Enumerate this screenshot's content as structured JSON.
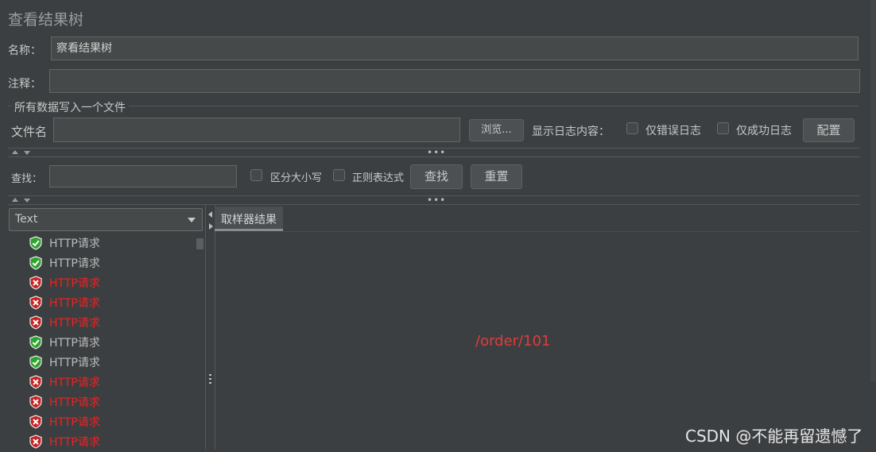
{
  "panel": {
    "title": "查看结果树"
  },
  "name_row": {
    "label": "名称：",
    "value": "察看结果树"
  },
  "comment_row": {
    "label": "注释：",
    "value": ""
  },
  "file_section": {
    "legend": "所有数据写入一个文件",
    "filename_label": "文件名",
    "filename_value": "",
    "browse_label": "浏览...",
    "log_label": "显示日志内容：",
    "errors_only_label": "仅错误日志",
    "success_only_label": "仅成功日志",
    "config_label": "配置"
  },
  "search_row": {
    "label": "查找：",
    "value": "",
    "case_label": "区分大小写",
    "regex_label": "正则表达式",
    "find_label": "查找",
    "reset_label": "重置"
  },
  "renderer_select": {
    "selected": "Text"
  },
  "results_tree": {
    "items": [
      {
        "label": "HTTP请求",
        "status": "success"
      },
      {
        "label": "HTTP请求",
        "status": "success"
      },
      {
        "label": "HTTP请求",
        "status": "error"
      },
      {
        "label": "HTTP请求",
        "status": "error"
      },
      {
        "label": "HTTP请求",
        "status": "error"
      },
      {
        "label": "HTTP请求",
        "status": "success"
      },
      {
        "label": "HTTP请求",
        "status": "success"
      },
      {
        "label": "HTTP请求",
        "status": "error"
      },
      {
        "label": "HTTP请求",
        "status": "error"
      },
      {
        "label": "HTTP请求",
        "status": "error"
      },
      {
        "label": "HTTP请求",
        "status": "error"
      }
    ]
  },
  "detail": {
    "tab_label": "取样器结果",
    "content_text": "/order/101"
  },
  "watermark": "CSDN @不能再留遗憾了",
  "colors": {
    "success": "#22aa22",
    "error": "#ee2222",
    "background": "#3c3f41"
  }
}
